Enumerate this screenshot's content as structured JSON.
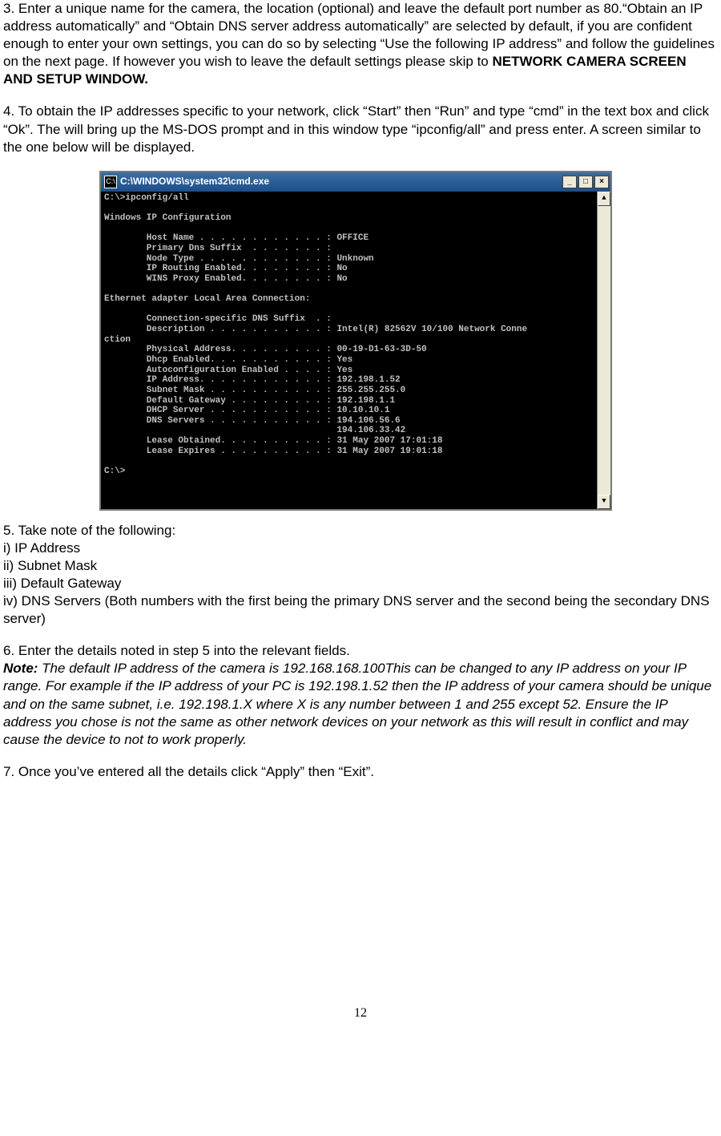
{
  "step3": {
    "text_pre": "3. Enter a unique name for the camera, the location (optional) and leave the default port number as 80.“Obtain an IP address automatically” and “Obtain DNS server address automatically” are selected by default, if you are confident enough to enter your own settings, you can do so by selecting “Use the following IP address” and follow the guidelines on the next page. If however you wish to leave the default settings please skip to ",
    "text_bold": "NETWORK CAMERA SCREEN AND SETUP WINDOW."
  },
  "step4": "4. To obtain the IP addresses specific to your network, click “Start” then “Run” and type “cmd” in the text box and click “Ok”. The will bring up the MS-DOS prompt and in this window type “ipconfig/all” and press enter. A screen similar to the one below will be displayed.",
  "cmd": {
    "title": "C:\\WINDOWS\\system32\\cmd.exe",
    "icon": "C:\\",
    "min": "_",
    "max": "□",
    "close": "×",
    "up": "▲",
    "down": "▼",
    "body": "C:\\>ipconfig/all\n\nWindows IP Configuration\n\n        Host Name . . . . . . . . . . . . : OFFICE\n        Primary Dns Suffix  . . . . . . . :\n        Node Type . . . . . . . . . . . . : Unknown\n        IP Routing Enabled. . . . . . . . : No\n        WINS Proxy Enabled. . . . . . . . : No\n\nEthernet adapter Local Area Connection:\n\n        Connection-specific DNS Suffix  . :\n        Description . . . . . . . . . . . : Intel(R) 82562V 10/100 Network Conne\nction\n        Physical Address. . . . . . . . . : 00-19-D1-63-3D-50\n        Dhcp Enabled. . . . . . . . . . . : Yes\n        Autoconfiguration Enabled . . . . : Yes\n        IP Address. . . . . . . . . . . . : 192.198.1.52\n        Subnet Mask . . . . . . . . . . . : 255.255.255.0\n        Default Gateway . . . . . . . . . : 192.198.1.1\n        DHCP Server . . . . . . . . . . . : 10.10.10.1\n        DNS Servers . . . . . . . . . . . : 194.106.56.6\n                                            194.106.33.42\n        Lease Obtained. . . . . . . . . . : 31 May 2007 17:01:18\n        Lease Expires . . . . . . . . . . : 31 May 2007 19:01:18\n\nC:\\>"
  },
  "step5": {
    "lead": "5. Take note of the following:",
    "i": "i) IP Address",
    "ii": "ii) Subnet Mask",
    "iii": "iii) Default Gateway",
    "iv": "iv) DNS Servers (Both numbers with the first being the primary DNS server and the second being the secondary DNS server)"
  },
  "step6": {
    "lead": "6. Enter the details noted in step 5 into the relevant fields.",
    "note_label": "Note:",
    "note_body": " The default IP address of the camera is 192.168.168.100This can be changed to any IP address on your IP range. For example if the IP address of your PC is 192.198.1.52 then the IP address of your camera should be unique and on the same subnet, i.e. 192.198.1.X where X is any number between 1 and 255 except 52. Ensure the IP address you chose is not the same as other network devices on your network as this will result in conflict and may cause the device to not to work properly."
  },
  "step7": "7. Once you’ve entered all the details click “Apply” then “Exit”.",
  "page_number": "12"
}
